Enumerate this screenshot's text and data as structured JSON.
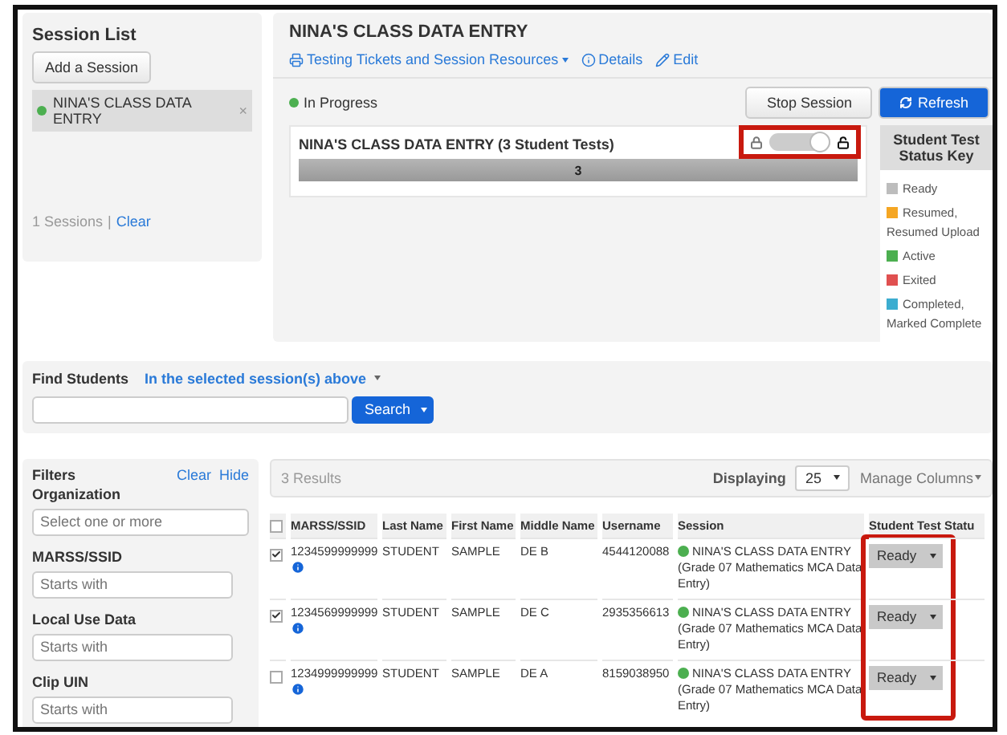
{
  "session_list": {
    "title": "Session List",
    "add_button": "Add a Session",
    "sessions": [
      {
        "name": "NINA'S CLASS DATA ENTRY",
        "selected": true,
        "color": "#4caf50",
        "remove": "×"
      }
    ],
    "count": "1 Sessions",
    "separator": "|",
    "clear": "Clear"
  },
  "session": {
    "title": "NINA'S CLASS DATA ENTRY",
    "links": [
      {
        "kind": "dropdown",
        "label": "Testing Tickets and Session Resources"
      },
      {
        "kind": "info",
        "label": "Details"
      },
      {
        "kind": "edit",
        "label": "Edit"
      }
    ],
    "status": {
      "label": "In Progress",
      "color": "#4caf50"
    },
    "buttons": [
      {
        "label": "Stop Session",
        "kind": "default"
      },
      {
        "label": "Refresh",
        "kind": "primary"
      }
    ],
    "card": {
      "title": "NINA'S CLASS DATA ENTRY (3 Student Tests)",
      "lock": {
        "locked": false,
        "highlighted": true
      },
      "progress": {
        "label": "3",
        "level": 1
      }
    },
    "status_key": {
      "title": "Student Test Status Key",
      "items": [
        {
          "label": "Ready",
          "color": "#bdbdbd"
        },
        {
          "label": "Resumed, Resumed Upload",
          "color": "#f5a623"
        },
        {
          "label": "Active",
          "color": "#4caf50"
        },
        {
          "label": "Exited",
          "color": "#e05050"
        },
        {
          "label": "Completed, Marked Complete",
          "color": "#3cadd0"
        }
      ]
    }
  },
  "find_students": {
    "title": "Find Students",
    "scope": "In the selected session(s) above",
    "search_button": "Search"
  },
  "filters": {
    "title": "Filters",
    "clear": "Clear",
    "hide": "Hide",
    "groups": [
      {
        "label": "Organization",
        "placeholder": "Select one or more"
      },
      {
        "label": "MARSS/SSID",
        "placeholder": "Starts with"
      },
      {
        "label": "Local Use Data",
        "placeholder": "Starts with"
      },
      {
        "label": "Clip UIN",
        "placeholder": "Starts with"
      }
    ]
  },
  "results": {
    "count": "3 Results",
    "displaying_label": "Displaying",
    "page_size": "25",
    "manage_columns": "Manage Columns",
    "columns": [
      "MARSS/SSID",
      "Last Name",
      "First Name",
      "Middle Name",
      "Username",
      "Session",
      "Student Test Statu"
    ],
    "status_column_highlighted": true,
    "select_all_checked": false,
    "rows": [
      {
        "checked": true,
        "marss": "1234599999999",
        "last": "STUDENT",
        "first": "SAMPLE",
        "middle": "DE B",
        "username": "4544120088",
        "session": "NINA'S CLASS DATA ENTRY",
        "session_detail": "(Grade 07 Mathematics MCA Data Entry)",
        "status": "Ready"
      },
      {
        "checked": true,
        "marss": "1234569999999",
        "last": "STUDENT",
        "first": "SAMPLE",
        "middle": "DE C",
        "username": "2935356613",
        "session": "NINA'S CLASS DATA ENTRY",
        "session_detail": "(Grade 07 Mathematics MCA Data Entry)",
        "status": "Ready"
      },
      {
        "checked": false,
        "marss": "1234999999999",
        "last": "STUDENT",
        "first": "SAMPLE",
        "middle": "DE A",
        "username": "8159038950",
        "session": "NINA'S CLASS DATA ENTRY",
        "session_detail": "(Grade 07 Mathematics MCA Data Entry)",
        "status": "Ready"
      }
    ]
  }
}
